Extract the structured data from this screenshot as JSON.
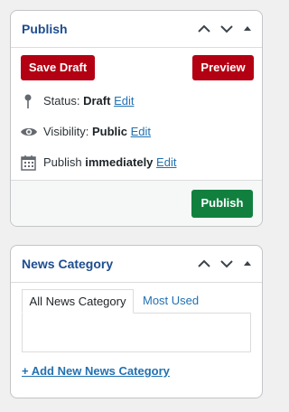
{
  "publish_panel": {
    "title": "Publish",
    "save_draft_label": "Save Draft",
    "preview_label": "Preview",
    "status": {
      "label": "Status:",
      "value": "Draft",
      "edit": "Edit"
    },
    "visibility": {
      "label": "Visibility:",
      "value": "Public",
      "edit": "Edit"
    },
    "schedule": {
      "label": "Publish",
      "value": "immediately",
      "edit": "Edit"
    },
    "publish_label": "Publish"
  },
  "category_panel": {
    "title": "News Category",
    "tabs": [
      {
        "label": "All News Category",
        "active": true
      },
      {
        "label": "Most Used",
        "active": false
      }
    ],
    "add_new_label": "+ Add New News Category"
  },
  "icons": {
    "move_up": "chevron-up-icon",
    "move_down": "chevron-down-icon",
    "toggle": "triangle-up-icon",
    "status": "pin-icon",
    "visibility": "eye-icon",
    "schedule": "calendar-icon"
  },
  "colors": {
    "panel_title": "#1d4d8f",
    "link": "#2271b1",
    "danger_button": "#b30012",
    "primary_button": "#11803f",
    "background": "#f0f0f1"
  }
}
